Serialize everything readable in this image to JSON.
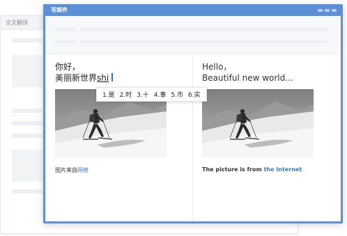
{
  "background_window": {
    "title": "全文翻译"
  },
  "compose_window": {
    "title": "写邮件"
  },
  "source_pane": {
    "line1": "你好，",
    "line2_committed": "美丽新世界",
    "line2_composing": "shi",
    "caption_prefix": "图片来自",
    "caption_link": "网络",
    "image": "skier-photo"
  },
  "translation_pane": {
    "line1": "Hello，",
    "line2": "Beautiful new world...",
    "caption_prefix": "The picture is from ",
    "caption_link": "the Internet",
    "image": "skier-photo"
  },
  "ime_candidates": [
    "1.是",
    "2.时",
    "3.十",
    "4.事",
    "5.市",
    "6.实"
  ],
  "colors": {
    "accent": "#5b8fd6",
    "link": "#3a7bd5",
    "caret": "#2f6cd0"
  }
}
